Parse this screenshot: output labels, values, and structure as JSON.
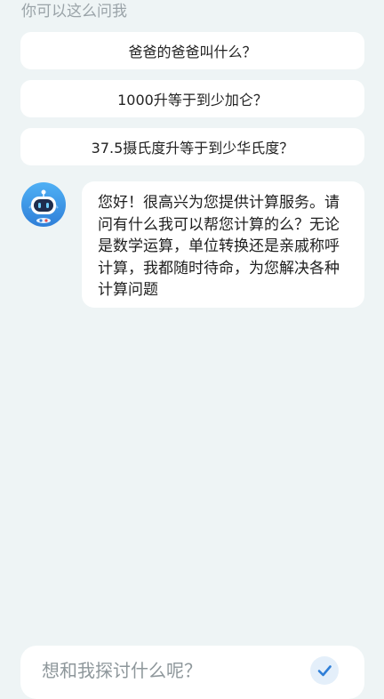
{
  "hint": {
    "title": "你可以这么问我"
  },
  "suggestions": [
    {
      "label": "爸爸的爸爸叫什么？"
    },
    {
      "label": "1000升等于到少加仑？"
    },
    {
      "label": "37.5摄氏度升等于到少华氏度？"
    }
  ],
  "chat": {
    "bot_avatar_icon": "robot-icon",
    "bot_message": "您好！很高兴为您提供计算服务。请问有什么我可以帮您计算的么？无论是数学运算，单位转换还是亲戚称呼计算，我都随时待命，为您解决各种计算问题"
  },
  "input": {
    "placeholder": "想和我探讨什么呢？",
    "send_icon": "check-icon"
  },
  "colors": {
    "background": "#eef4f5",
    "card": "#ffffff",
    "accent": "#2f7fd8"
  }
}
